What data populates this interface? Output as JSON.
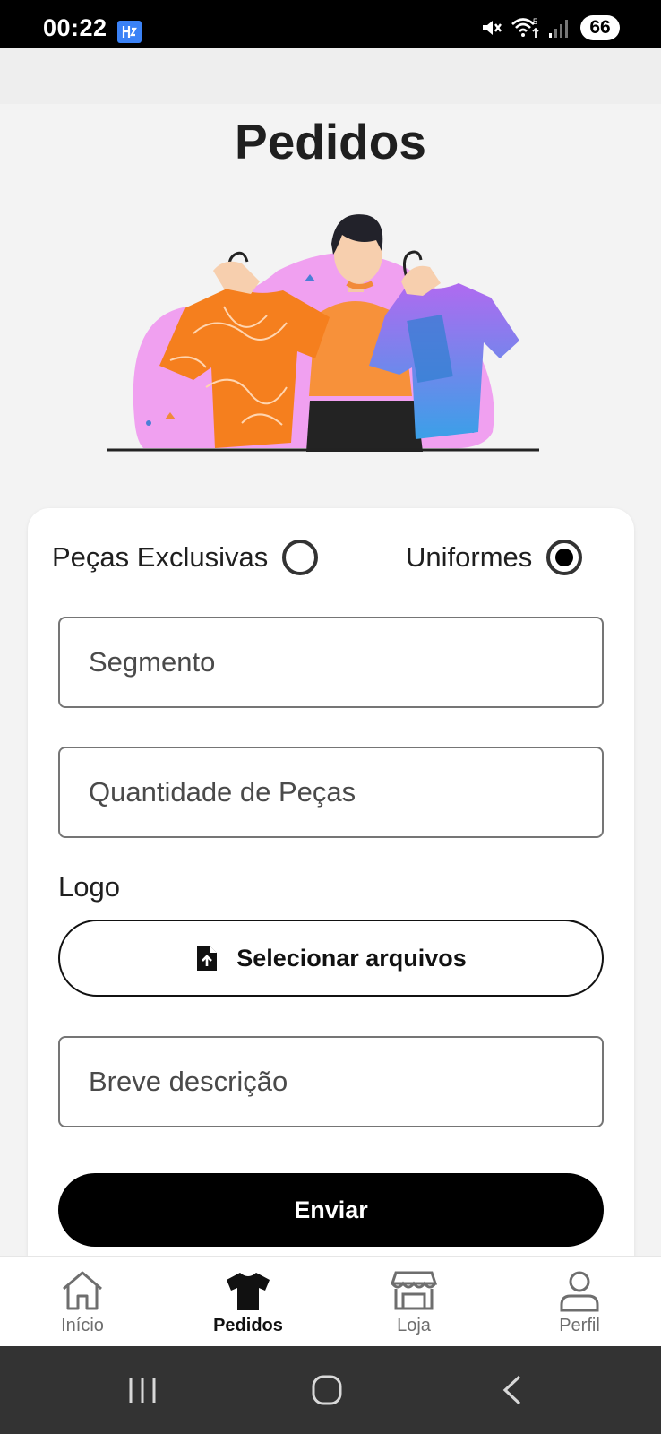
{
  "status_bar": {
    "time": "00:22",
    "battery": "66",
    "wifi_badge": "5"
  },
  "header": {
    "title": "Pedidos"
  },
  "illustration": {
    "name": "person-holding-shirts-illustration"
  },
  "form": {
    "options": [
      {
        "label": "Peças Exclusivas",
        "selected": false
      },
      {
        "label": "Uniformes",
        "selected": true
      }
    ],
    "segment_placeholder": "Segmento",
    "quantity_placeholder": "Quantidade de Peças",
    "logo_label": "Logo",
    "file_button_label": "Selecionar arquivos",
    "description_placeholder": "Breve descrição",
    "submit_label": "Enviar"
  },
  "tabs": [
    {
      "label": "Início",
      "icon": "home-icon",
      "active": false
    },
    {
      "label": "Pedidos",
      "icon": "tshirt-icon",
      "active": true
    },
    {
      "label": "Loja",
      "icon": "store-icon",
      "active": false
    },
    {
      "label": "Perfil",
      "icon": "user-icon",
      "active": false
    }
  ],
  "colors": {
    "accent": "#000000",
    "tab_inactive": "#6e6e6e"
  }
}
